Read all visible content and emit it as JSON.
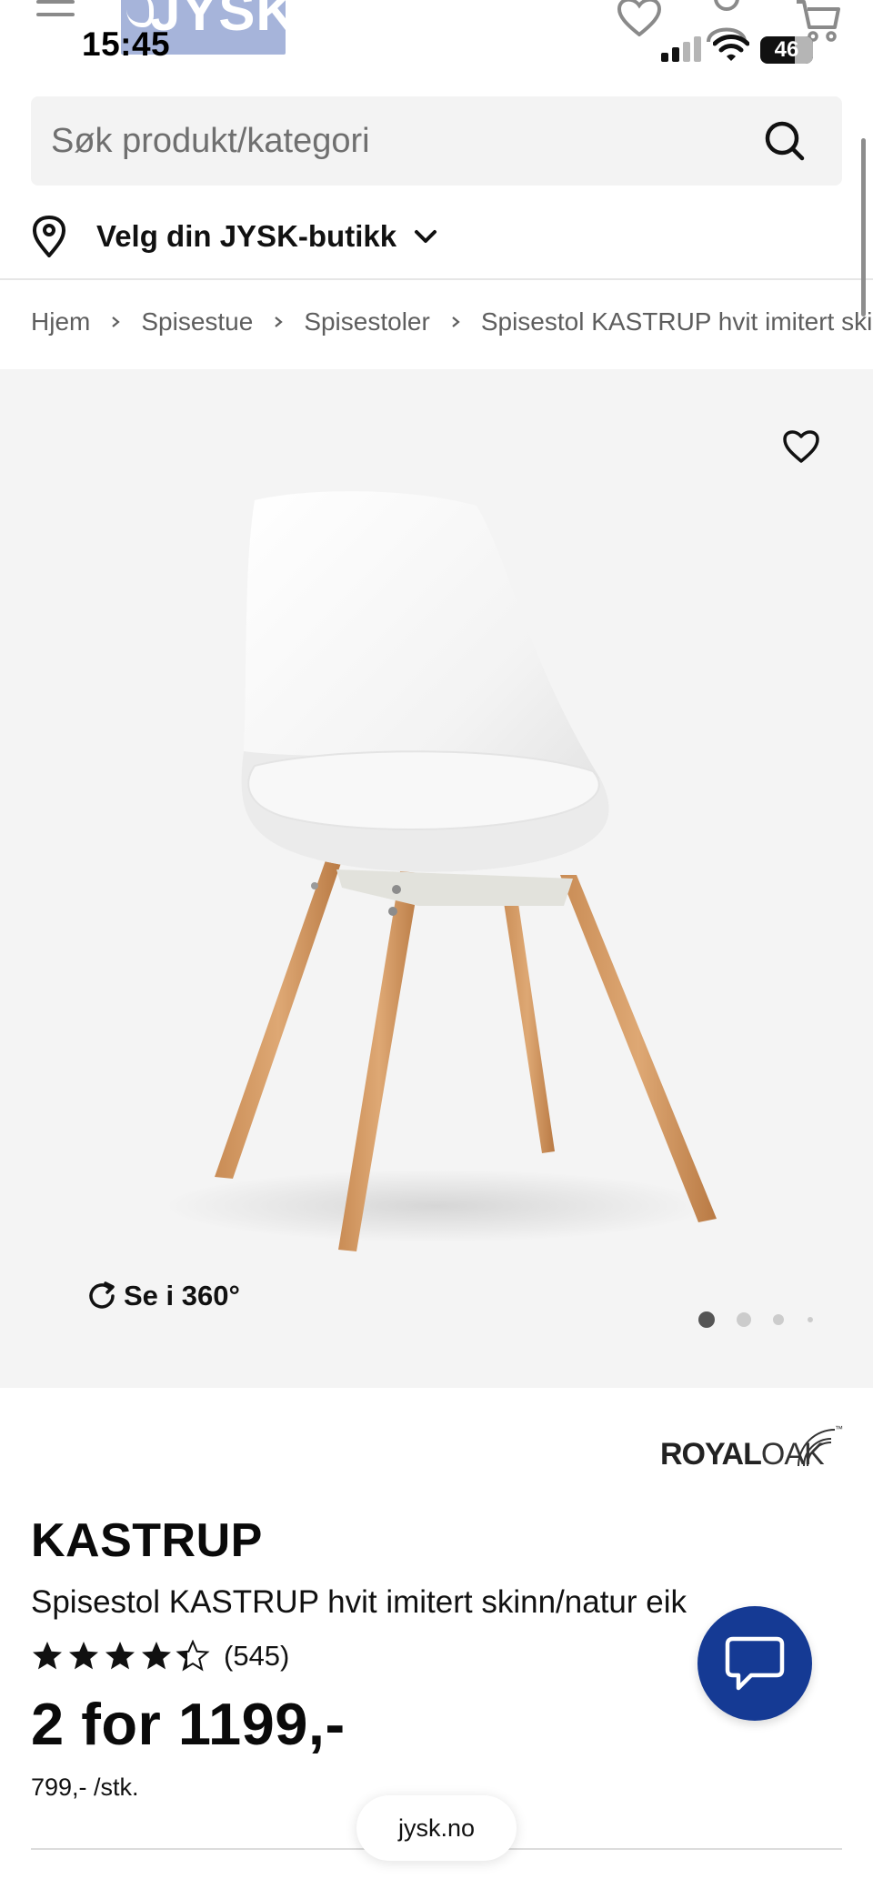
{
  "status_bar": {
    "time": "15:45",
    "battery": "46",
    "icons": [
      "cellular-signal-icon",
      "wifi-icon",
      "battery-icon"
    ]
  },
  "header": {
    "logo_text": "JYSK",
    "icons": [
      "hamburger-menu-icon",
      "heart-icon",
      "account-icon",
      "cart-icon"
    ]
  },
  "search": {
    "placeholder": "Søk produkt/kategori",
    "value": "",
    "icon": "search-icon"
  },
  "store_selector": {
    "label": "Velg din JYSK-butikk",
    "icons": [
      "location-pin-icon",
      "chevron-down-icon"
    ]
  },
  "breadcrumb": {
    "items": [
      "Hjem",
      "Spisestue",
      "Spisestoler",
      "Spisestol KASTRUP hvit imitert ski"
    ]
  },
  "gallery": {
    "view360_label": "Se i 360°",
    "image_count": 4,
    "active_index": 0
  },
  "product": {
    "brand": "ROYALOAK",
    "brand_parts": [
      "ROYAL",
      "OAK"
    ],
    "brand_tm": "™",
    "name": "KASTRUP",
    "description": "Spisestol KASTRUP hvit imitert skinn/natur eik",
    "rating": 4.5,
    "rating_count": "(545)",
    "price": "2 for 1199,-",
    "unit_price": "799,- /stk."
  },
  "footer": {
    "url": "jysk.no"
  },
  "colors": {
    "brand_blue": "#153a94",
    "logo_bg": "#a6b4da",
    "gallery_bg": "#f4f4f4",
    "search_bg": "#f3f3f3",
    "text": "#111111",
    "muted_text": "#5e5e5e"
  }
}
